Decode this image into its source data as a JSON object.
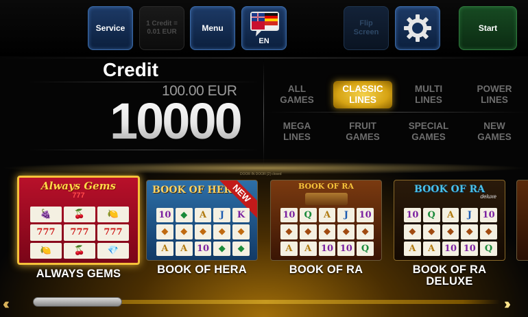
{
  "topbar": {
    "service": "Service",
    "credit_rate_1": "1 Credit =",
    "credit_rate_2": "0.01 EUR",
    "menu": "Menu",
    "language": "EN",
    "flip_1": "Flip",
    "flip_2": "Screen",
    "start": "Start"
  },
  "credit": {
    "label": "Credit",
    "eur": "100.00 EUR",
    "value": "10000"
  },
  "categories": [
    {
      "l1": "ALL",
      "l2": "GAMES"
    },
    {
      "l1": "CLASSIC",
      "l2": "LINES"
    },
    {
      "l1": "MULTI",
      "l2": "LINES"
    },
    {
      "l1": "POWER",
      "l2": "LINES"
    },
    {
      "l1": "MEGA",
      "l2": "LINES"
    },
    {
      "l1": "FRUIT",
      "l2": "GAMES"
    },
    {
      "l1": "SPECIAL",
      "l2": "GAMES"
    },
    {
      "l1": "NEW",
      "l2": "GAMES"
    }
  ],
  "door_note": "DOOR IN DOOR [2] closed",
  "games": [
    {
      "name": "ALWAYS GEMS",
      "logo": "Always Gems",
      "logo_sub": "777"
    },
    {
      "name": "BOOK OF HERA",
      "logo": "BOOK OF HERA",
      "badge": "NEW"
    },
    {
      "name": "BOOK OF RA",
      "logo": "BOOK OF RA"
    },
    {
      "name": "BOOK OF RA",
      "name2": "DELUXE",
      "logo": "BOOK OF RA",
      "logo_sub": "deluxe"
    }
  ],
  "symbols": {
    "hera": [
      "10",
      "◆",
      "A",
      "J",
      "K",
      "◆",
      "◆",
      "◆",
      "◆",
      "◆",
      "A",
      "A",
      "10",
      "◆",
      "◆"
    ],
    "ra": [
      "10",
      "Q",
      "A",
      "J",
      "10",
      "◆",
      "◆",
      "◆",
      "◆",
      "◆",
      "A",
      "A",
      "10",
      "10",
      "Q"
    ],
    "radx": [
      "10",
      "Q",
      "A",
      "J",
      "10",
      "◆",
      "◆",
      "◆",
      "◆",
      "◆",
      "A",
      "A",
      "10",
      "10",
      "Q"
    ],
    "gems": [
      "🍇",
      "🍒",
      "🍋",
      "777",
      "777",
      "777",
      "🍋",
      "🍒",
      "💎"
    ]
  },
  "colors": {
    "accent_gold": "#f5c23a",
    "button_blue": "#1d3a66",
    "start_green": "#174a22"
  }
}
